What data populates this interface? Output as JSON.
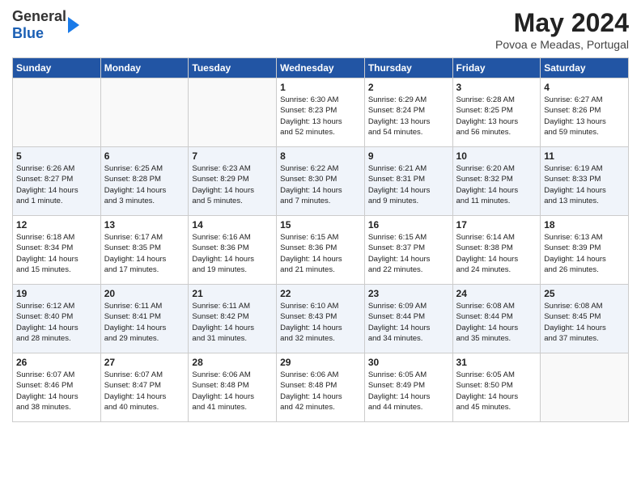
{
  "header": {
    "logo_general": "General",
    "logo_blue": "Blue",
    "title": "May 2024",
    "subtitle": "Povoa e Meadas, Portugal"
  },
  "weekdays": [
    "Sunday",
    "Monday",
    "Tuesday",
    "Wednesday",
    "Thursday",
    "Friday",
    "Saturday"
  ],
  "weeks": [
    [
      {
        "day": "",
        "info": ""
      },
      {
        "day": "",
        "info": ""
      },
      {
        "day": "",
        "info": ""
      },
      {
        "day": "1",
        "info": "Sunrise: 6:30 AM\nSunset: 8:23 PM\nDaylight: 13 hours\nand 52 minutes."
      },
      {
        "day": "2",
        "info": "Sunrise: 6:29 AM\nSunset: 8:24 PM\nDaylight: 13 hours\nand 54 minutes."
      },
      {
        "day": "3",
        "info": "Sunrise: 6:28 AM\nSunset: 8:25 PM\nDaylight: 13 hours\nand 56 minutes."
      },
      {
        "day": "4",
        "info": "Sunrise: 6:27 AM\nSunset: 8:26 PM\nDaylight: 13 hours\nand 59 minutes."
      }
    ],
    [
      {
        "day": "5",
        "info": "Sunrise: 6:26 AM\nSunset: 8:27 PM\nDaylight: 14 hours\nand 1 minute."
      },
      {
        "day": "6",
        "info": "Sunrise: 6:25 AM\nSunset: 8:28 PM\nDaylight: 14 hours\nand 3 minutes."
      },
      {
        "day": "7",
        "info": "Sunrise: 6:23 AM\nSunset: 8:29 PM\nDaylight: 14 hours\nand 5 minutes."
      },
      {
        "day": "8",
        "info": "Sunrise: 6:22 AM\nSunset: 8:30 PM\nDaylight: 14 hours\nand 7 minutes."
      },
      {
        "day": "9",
        "info": "Sunrise: 6:21 AM\nSunset: 8:31 PM\nDaylight: 14 hours\nand 9 minutes."
      },
      {
        "day": "10",
        "info": "Sunrise: 6:20 AM\nSunset: 8:32 PM\nDaylight: 14 hours\nand 11 minutes."
      },
      {
        "day": "11",
        "info": "Sunrise: 6:19 AM\nSunset: 8:33 PM\nDaylight: 14 hours\nand 13 minutes."
      }
    ],
    [
      {
        "day": "12",
        "info": "Sunrise: 6:18 AM\nSunset: 8:34 PM\nDaylight: 14 hours\nand 15 minutes."
      },
      {
        "day": "13",
        "info": "Sunrise: 6:17 AM\nSunset: 8:35 PM\nDaylight: 14 hours\nand 17 minutes."
      },
      {
        "day": "14",
        "info": "Sunrise: 6:16 AM\nSunset: 8:36 PM\nDaylight: 14 hours\nand 19 minutes."
      },
      {
        "day": "15",
        "info": "Sunrise: 6:15 AM\nSunset: 8:36 PM\nDaylight: 14 hours\nand 21 minutes."
      },
      {
        "day": "16",
        "info": "Sunrise: 6:15 AM\nSunset: 8:37 PM\nDaylight: 14 hours\nand 22 minutes."
      },
      {
        "day": "17",
        "info": "Sunrise: 6:14 AM\nSunset: 8:38 PM\nDaylight: 14 hours\nand 24 minutes."
      },
      {
        "day": "18",
        "info": "Sunrise: 6:13 AM\nSunset: 8:39 PM\nDaylight: 14 hours\nand 26 minutes."
      }
    ],
    [
      {
        "day": "19",
        "info": "Sunrise: 6:12 AM\nSunset: 8:40 PM\nDaylight: 14 hours\nand 28 minutes."
      },
      {
        "day": "20",
        "info": "Sunrise: 6:11 AM\nSunset: 8:41 PM\nDaylight: 14 hours\nand 29 minutes."
      },
      {
        "day": "21",
        "info": "Sunrise: 6:11 AM\nSunset: 8:42 PM\nDaylight: 14 hours\nand 31 minutes."
      },
      {
        "day": "22",
        "info": "Sunrise: 6:10 AM\nSunset: 8:43 PM\nDaylight: 14 hours\nand 32 minutes."
      },
      {
        "day": "23",
        "info": "Sunrise: 6:09 AM\nSunset: 8:44 PM\nDaylight: 14 hours\nand 34 minutes."
      },
      {
        "day": "24",
        "info": "Sunrise: 6:08 AM\nSunset: 8:44 PM\nDaylight: 14 hours\nand 35 minutes."
      },
      {
        "day": "25",
        "info": "Sunrise: 6:08 AM\nSunset: 8:45 PM\nDaylight: 14 hours\nand 37 minutes."
      }
    ],
    [
      {
        "day": "26",
        "info": "Sunrise: 6:07 AM\nSunset: 8:46 PM\nDaylight: 14 hours\nand 38 minutes."
      },
      {
        "day": "27",
        "info": "Sunrise: 6:07 AM\nSunset: 8:47 PM\nDaylight: 14 hours\nand 40 minutes."
      },
      {
        "day": "28",
        "info": "Sunrise: 6:06 AM\nSunset: 8:48 PM\nDaylight: 14 hours\nand 41 minutes."
      },
      {
        "day": "29",
        "info": "Sunrise: 6:06 AM\nSunset: 8:48 PM\nDaylight: 14 hours\nand 42 minutes."
      },
      {
        "day": "30",
        "info": "Sunrise: 6:05 AM\nSunset: 8:49 PM\nDaylight: 14 hours\nand 44 minutes."
      },
      {
        "day": "31",
        "info": "Sunrise: 6:05 AM\nSunset: 8:50 PM\nDaylight: 14 hours\nand 45 minutes."
      },
      {
        "day": "",
        "info": ""
      }
    ]
  ]
}
